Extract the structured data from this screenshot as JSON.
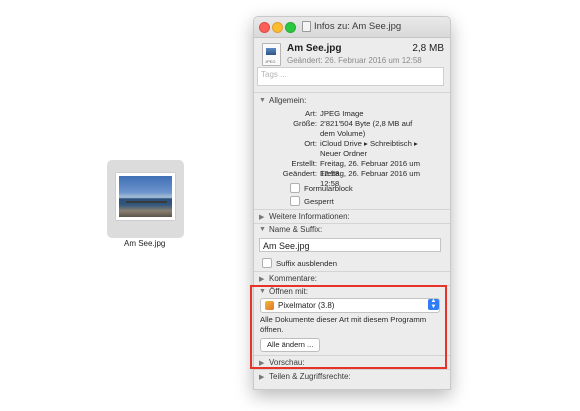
{
  "desktop_file": {
    "label": "Am See.jpg"
  },
  "window": {
    "title": "Infos zu: Am See.jpg",
    "file_name": "Am See.jpg",
    "file_size": "2,8 MB",
    "modified": "Geändert: 26. Februar 2016 um 12:58",
    "tags_placeholder": "Tags ...",
    "icon_badge": "JPEG"
  },
  "general": {
    "header": "Allgemein:",
    "rows": [
      {
        "label": "Art:",
        "value": "JPEG Image"
      },
      {
        "label": "Größe:",
        "value": "2'821'504 Byte (2,8 MB auf dem Volume)"
      },
      {
        "label": "Ort:",
        "value": "iCloud Drive ▸ Schreibtisch ▸ Neuer Ordner"
      },
      {
        "label": "Erstellt:",
        "value": "Freitag, 26. Februar 2016 um 12:58"
      },
      {
        "label": "Geändert:",
        "value": "Freitag, 26. Februar 2016 um 12:58"
      }
    ],
    "formularblock": "Formularblock",
    "locked": "Gesperrt"
  },
  "more_info": {
    "header": "Weitere Informationen:"
  },
  "name_suffix": {
    "header": "Name & Suffix:",
    "value": "Am See.jpg",
    "hide_suffix": "Suffix ausblenden"
  },
  "comments": {
    "header": "Kommentare:"
  },
  "open_with": {
    "header": "Öffnen mit:",
    "app": "Pixelmator (3.8)",
    "description": "Alle Dokumente dieser Art mit diesem Programm öffnen.",
    "change_all": "Alle ändern ..."
  },
  "preview": {
    "header": "Vorschau:"
  },
  "sharing": {
    "header": "Teilen & Zugriffsrechte:"
  },
  "colors": {
    "highlight": "#e8332a",
    "popup_accent": "#2f7cf6"
  }
}
